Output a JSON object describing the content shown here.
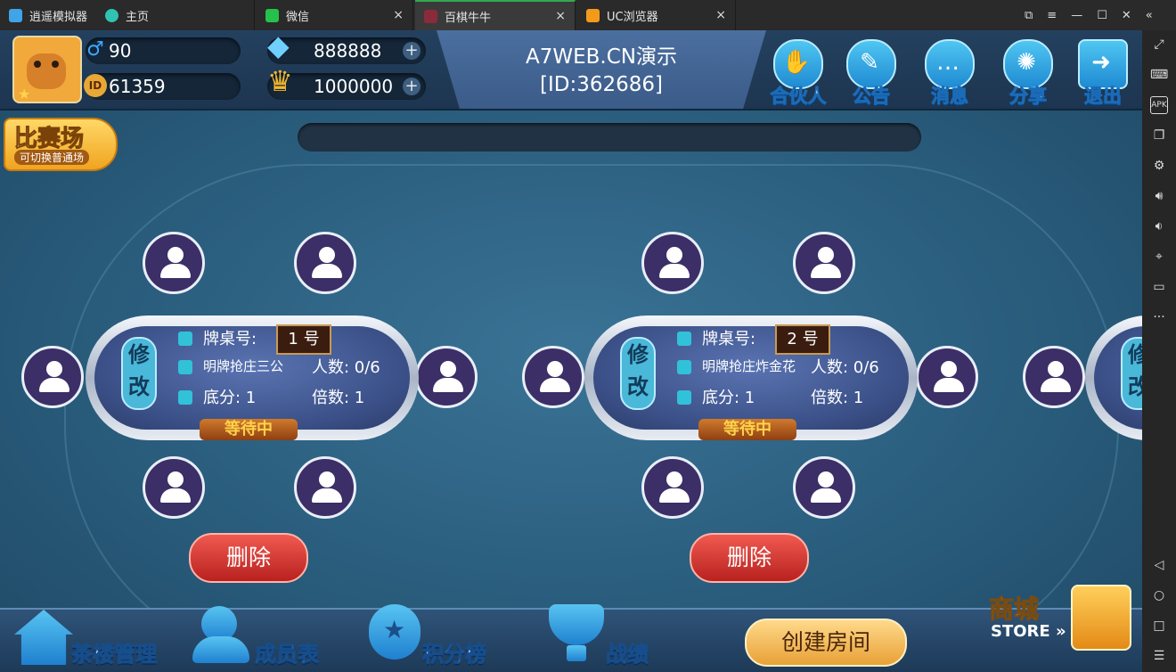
{
  "browser": {
    "tabs": [
      {
        "label": "逍遥模拟器",
        "active": false
      },
      {
        "label": "主页",
        "active": false
      },
      {
        "label": "微信",
        "active": false
      },
      {
        "label": "百棋牛牛",
        "active": true
      },
      {
        "label": "UC浏览器",
        "active": false
      }
    ],
    "close_glyph": "×",
    "window_controls": [
      "⧉",
      "≡",
      "—",
      "☐",
      "✕"
    ],
    "collapse_glyph": "«"
  },
  "sidebar": {
    "icons": [
      "fullscreen-icon",
      "keyboard-icon",
      "apk-icon",
      "multi-window-icon",
      "settings-icon",
      "volume-up-icon",
      "volume-down-icon",
      "location-icon",
      "folder-icon",
      "more-icon",
      "back-icon",
      "home-icon",
      "recent-apps-icon",
      "menu-icon"
    ],
    "more_glyph": "···"
  },
  "player": {
    "gender_value": "90",
    "id_value": "61359",
    "id_badge": "ID"
  },
  "currency": {
    "diamonds": "888888",
    "trophies": "1000000",
    "plus": "+"
  },
  "center": {
    "site": "A7WEB.CN演示",
    "room_id": "[ID:362686]"
  },
  "top_buttons": [
    {
      "label": "合伙人",
      "icon": "handshake-icon"
    },
    {
      "label": "公告",
      "icon": "announcement-icon"
    },
    {
      "label": "消息",
      "icon": "message-icon"
    },
    {
      "label": "分享",
      "icon": "share-icon"
    },
    {
      "label": "退出",
      "icon": "exit-icon"
    }
  ],
  "match_badge": {
    "title": "比赛场",
    "subtitle": "可切换普通场"
  },
  "tables": [
    {
      "modify": "修改",
      "table_no_label": "牌桌号:",
      "table_no": "1 号",
      "game": "明牌抢庄三公",
      "players": "人数: 0/6",
      "base": "底分: 1",
      "multiplier": "倍数: 1",
      "status": "等待中",
      "delete": "删除"
    },
    {
      "modify": "修改",
      "table_no_label": "牌桌号:",
      "table_no": "2 号",
      "game": "明牌抢庄炸金花",
      "players": "人数: 0/6",
      "base": "底分: 1",
      "multiplier": "倍数: 1",
      "status": "等待中",
      "delete": "删除"
    }
  ],
  "bottom_nav": [
    {
      "label": "茶楼管理",
      "icon": "house-icon"
    },
    {
      "label": "成员表",
      "icon": "members-icon"
    },
    {
      "label": "积分榜",
      "icon": "medal-icon"
    },
    {
      "label": "战绩",
      "icon": "trophy-icon"
    }
  ],
  "create_room": "创建房间",
  "store": {
    "title": "商城",
    "subtitle": "STORE »"
  }
}
